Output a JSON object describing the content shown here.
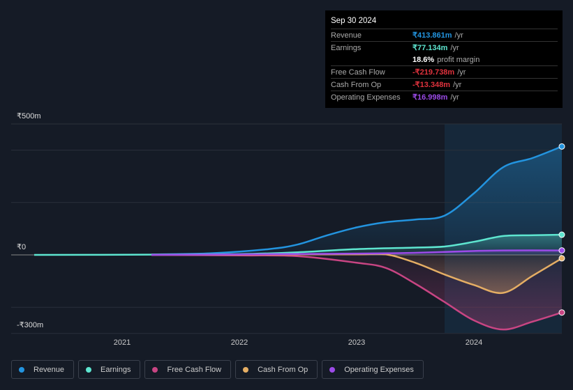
{
  "tooltip": {
    "date": "Sep 30 2024",
    "rows": [
      {
        "label": "Revenue",
        "value": "₹413.861m",
        "unit": "/yr",
        "color": "#2394df"
      },
      {
        "label": "Earnings",
        "value": "₹77.134m",
        "unit": "/yr",
        "color": "#5ee6d0"
      },
      {
        "label": "",
        "value": "18.6%",
        "unit": "profit margin",
        "color": "#ffffff"
      },
      {
        "label": "Free Cash Flow",
        "value": "-₹219.738m",
        "unit": "/yr",
        "color": "#e0323d"
      },
      {
        "label": "Cash From Op",
        "value": "-₹13.348m",
        "unit": "/yr",
        "color": "#e0323d"
      },
      {
        "label": "Operating Expenses",
        "value": "₹16.998m",
        "unit": "/yr",
        "color": "#9c4be8"
      }
    ]
  },
  "chart_data": {
    "type": "line",
    "ylim": [
      -300,
      500
    ],
    "y_tick_labels": [
      "₹500m",
      "₹0",
      "-₹300m"
    ],
    "x_tick_labels": [
      "2021",
      "2022",
      "2023",
      "2024"
    ],
    "grid": true,
    "legend_placement": "bottom",
    "highlight_from": 2023.75,
    "series": [
      {
        "name": "Revenue",
        "color": "#2394df",
        "x": [
          2021.25,
          2021.75,
          2022.25,
          2022.5,
          2022.75,
          2023,
          2023.25,
          2023.5,
          2023.75,
          2024,
          2024.25,
          2024.5,
          2024.75
        ],
        "values": [
          2,
          6,
          22,
          40,
          75,
          105,
          125,
          135,
          150,
          235,
          335,
          370,
          414
        ]
      },
      {
        "name": "Earnings",
        "color": "#5ee6d0",
        "x": [
          2020.25,
          2021.25,
          2022,
          2022.5,
          2023,
          2023.5,
          2023.75,
          2024,
          2024.25,
          2024.5,
          2024.75
        ],
        "values": [
          0,
          1,
          3,
          10,
          22,
          28,
          32,
          50,
          72,
          75,
          77
        ]
      },
      {
        "name": "Free Cash Flow",
        "color": "#c84583",
        "x": [
          2021.25,
          2022,
          2022.5,
          2023,
          2023.25,
          2023.5,
          2023.75,
          2024,
          2024.25,
          2024.5,
          2024.75
        ],
        "values": [
          0,
          -2,
          -5,
          -30,
          -50,
          -110,
          -180,
          -250,
          -285,
          -255,
          -220
        ]
      },
      {
        "name": "Cash From Op",
        "color": "#e5ae64",
        "x": [
          2021.25,
          2022,
          2022.5,
          2023,
          2023.25,
          2023.5,
          2023.75,
          2024,
          2024.25,
          2024.5,
          2024.75
        ],
        "values": [
          0,
          1,
          2,
          2,
          2,
          -30,
          -75,
          -115,
          -145,
          -80,
          -13
        ]
      },
      {
        "name": "Operating Expenses",
        "color": "#9c4be8",
        "x": [
          2021.25,
          2022,
          2023,
          2023.5,
          2024,
          2024.25,
          2024.75
        ],
        "values": [
          0,
          2,
          5,
          8,
          15,
          17,
          17
        ]
      }
    ]
  }
}
